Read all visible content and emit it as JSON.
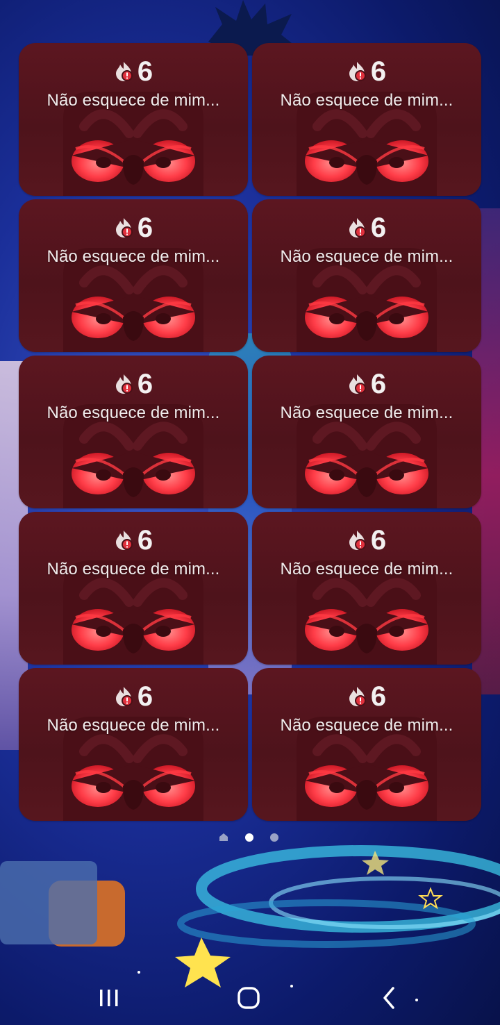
{
  "widgets": [
    {
      "streak": "6",
      "caption": "Não esquece de mim..."
    },
    {
      "streak": "6",
      "caption": "Não esquece de mim..."
    },
    {
      "streak": "6",
      "caption": "Não esquece de mim..."
    },
    {
      "streak": "6",
      "caption": "Não esquece de mim..."
    },
    {
      "streak": "6",
      "caption": "Não esquece de mim..."
    },
    {
      "streak": "6",
      "caption": "Não esquece de mim..."
    },
    {
      "streak": "6",
      "caption": "Não esquece de mim..."
    },
    {
      "streak": "6",
      "caption": "Não esquece de mim..."
    },
    {
      "streak": "6",
      "caption": "Não esquece de mim..."
    },
    {
      "streak": "6",
      "caption": "Não esquece de mim..."
    }
  ],
  "widget_icons": {
    "streak": "flame-icon",
    "mascot": "angry-owl-icon"
  },
  "pager": {
    "home_icon": "home-indicator-icon",
    "page_count": 2,
    "active_page": 1
  },
  "navbar": {
    "recents": "recents-icon",
    "home": "home-icon",
    "back": "back-icon"
  },
  "colors": {
    "widget_bg": "#5a1620",
    "eye_red": "#ff4a55",
    "text": "#f1ecec",
    "wallpaper": "#1b2f9a"
  }
}
